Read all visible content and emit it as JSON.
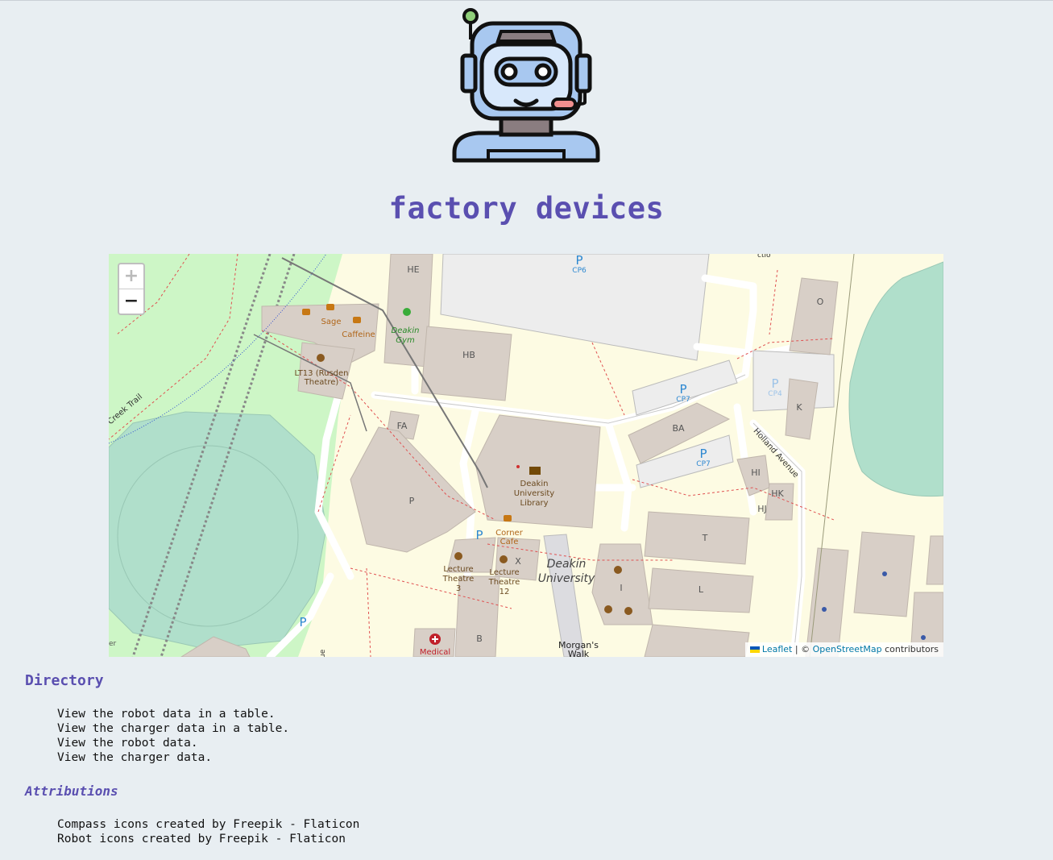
{
  "header": {
    "logo_icon": "robot-headset-icon",
    "title": "factory devices",
    "title_color": "#5a4fb0"
  },
  "map": {
    "zoom_in_label": "+",
    "zoom_out_label": "−",
    "attribution": {
      "leaflet_label": "Leaflet",
      "separator": " | © ",
      "osm_label": "OpenStreetMap",
      "suffix": " contributors"
    },
    "labels": {
      "he": "HE",
      "hb": "HB",
      "fa": "FA",
      "p": "P",
      "b": "B",
      "x": "X",
      "ba": "BA",
      "o": "O",
      "k": "K",
      "hi": "HI",
      "hk": "HK",
      "hj": "HJ",
      "t": "T",
      "i": "I",
      "l": "L",
      "sage": "Sage",
      "caffeine": "Caffeine",
      "gym1": "Deakin",
      "gym2": "Gym",
      "lt13a": "LT13 (Rusden",
      "lt13b": "Theatre)",
      "lib1": "Deakin",
      "lib2": "University",
      "lib3": "Library",
      "corner1": "Corner",
      "corner2": "Cafe",
      "lec3a": "Lecture",
      "lec3b": "Theatre",
      "lec3c": "3",
      "lec12a": "Lecture",
      "lec12b": "Theatre",
      "lec12c": "12",
      "deakin1": "Deakin",
      "deakin2": "University",
      "medical": "Medical",
      "morgan1": "Morgan's",
      "morgan2": "Walk",
      "cp6": "CP6",
      "cp7a": "CP7",
      "cp7b": "CP7",
      "cp4": "CP4",
      "parking": "P",
      "creek": "Creek Trail",
      "holland": "Holland Avenue",
      "edge_ue": "ue",
      "edge_er": "er",
      "edge_ct": "ctio"
    }
  },
  "directory": {
    "heading": "Directory",
    "items": [
      "View the robot data in a table.",
      "View the charger data in a table.",
      "View the robot data.",
      "View the charger data."
    ]
  },
  "attributions": {
    "heading": "Attributions",
    "items": [
      "Compass icons created by Freepik - Flaticon",
      "Robot icons created by Freepik - Flaticon"
    ]
  }
}
